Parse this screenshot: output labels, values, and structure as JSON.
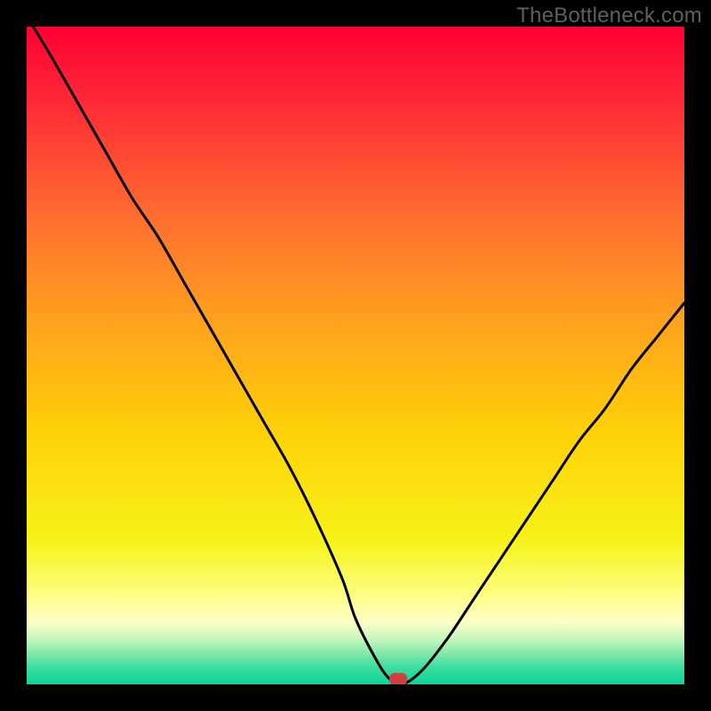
{
  "watermark": "TheBottleneck.com",
  "chart_data": {
    "type": "line",
    "title": "",
    "xlabel": "",
    "ylabel": "",
    "xlim": [
      0,
      100
    ],
    "ylim": [
      0,
      100
    ],
    "grid": false,
    "legend": false,
    "background": {
      "type": "vertical-gradient",
      "stops": [
        {
          "pos": 0.0,
          "color": "#ff0033"
        },
        {
          "pos": 0.12,
          "color": "#ff2b36"
        },
        {
          "pos": 0.28,
          "color": "#ff6a30"
        },
        {
          "pos": 0.45,
          "color": "#ffa21e"
        },
        {
          "pos": 0.62,
          "color": "#ffd208"
        },
        {
          "pos": 0.78,
          "color": "#f7f218"
        },
        {
          "pos": 0.86,
          "color": "#fdfe7e"
        },
        {
          "pos": 0.905,
          "color": "#fdffc5"
        },
        {
          "pos": 0.93,
          "color": "#c9f6c0"
        },
        {
          "pos": 0.955,
          "color": "#7ce8a8"
        },
        {
          "pos": 0.975,
          "color": "#39dca0"
        },
        {
          "pos": 1.0,
          "color": "#0fd49b"
        }
      ]
    },
    "series": [
      {
        "name": "bottleneck-curve",
        "color": "#000000",
        "x": [
          1,
          4,
          8,
          12,
          16,
          20,
          24,
          28,
          32,
          36,
          40,
          44,
          48,
          50,
          53,
          55,
          57,
          60,
          64,
          68,
          72,
          76,
          80,
          84,
          88,
          92,
          96,
          100
        ],
        "y": [
          100,
          95,
          88,
          81,
          74,
          68,
          61,
          54,
          47,
          40,
          33,
          25,
          16,
          10,
          4,
          1,
          0,
          2,
          7,
          13,
          19,
          25,
          31,
          37,
          42,
          48,
          53,
          58
        ]
      }
    ],
    "marker": {
      "x": 56.5,
      "y": 0.8,
      "shape": "rounded-rect",
      "color": "#d04040"
    }
  }
}
